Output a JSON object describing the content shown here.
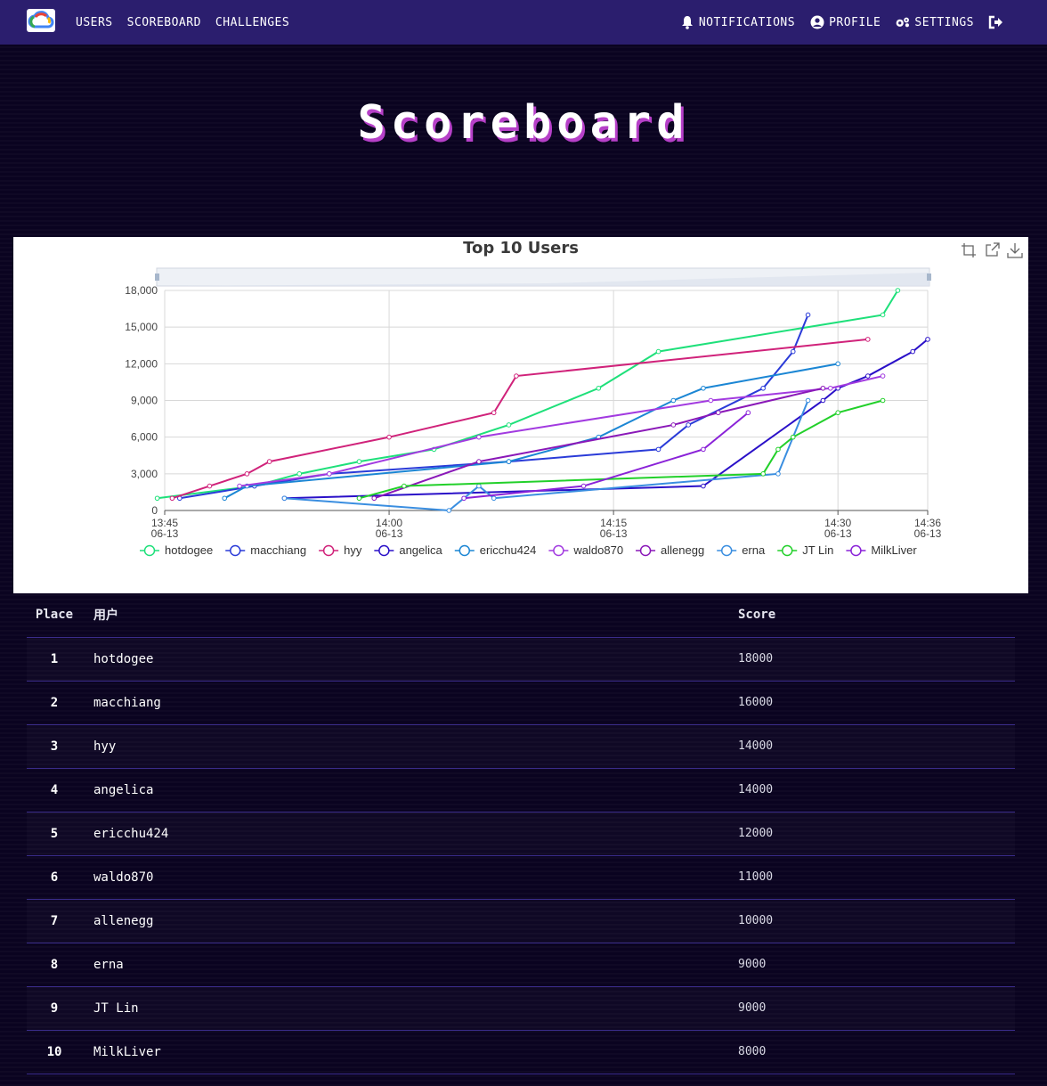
{
  "nav": {
    "left": [
      {
        "label": "USERS"
      },
      {
        "label": "SCOREBOARD"
      },
      {
        "label": "CHALLENGES"
      }
    ],
    "right": [
      {
        "label": "NOTIFICATIONS",
        "icon": "bell-icon"
      },
      {
        "label": "PROFILE",
        "icon": "user-circle-icon"
      },
      {
        "label": "SETTINGS",
        "icon": "gears-icon"
      }
    ],
    "logout_icon": "sign-out-icon",
    "brand_icon": "cloud-logo-icon",
    "background": "#2b1e6e"
  },
  "page": {
    "title": "Scoreboard",
    "title_shadow_color": "#b640c8",
    "background": "#0a0320"
  },
  "chart_data": {
    "type": "line",
    "title": "Top 10 Users",
    "xlabel": "",
    "ylabel": "",
    "ylim": [
      0,
      18000
    ],
    "yticks": [
      0,
      3000,
      6000,
      9000,
      12000,
      15000,
      18000
    ],
    "ytick_labels": [
      "0",
      "3,000",
      "6,000",
      "9,000",
      "12,000",
      "15,000",
      "18,000"
    ],
    "xlim": [
      "13:45",
      "14:36"
    ],
    "xticks": [
      {
        "time": "13:45",
        "date": "06-13"
      },
      {
        "time": "14:00",
        "date": "06-13"
      },
      {
        "time": "14:15",
        "date": "06-13"
      },
      {
        "time": "14:30",
        "date": "06-13"
      },
      {
        "time": "14:36",
        "date": "06-13"
      }
    ],
    "grid": true,
    "legend_position": "bottom",
    "toolbox": [
      "zoom-icon",
      "restore-icon",
      "download-icon"
    ],
    "datazoom_slider": true,
    "series": [
      {
        "name": "hotdogee",
        "color": "#1ee07a",
        "points": [
          [
            "13:44.5",
            1000
          ],
          [
            "13:51",
            2000
          ],
          [
            "13:54",
            3000
          ],
          [
            "13:58",
            4000
          ],
          [
            "14:03",
            5000
          ],
          [
            "14:08",
            7000
          ],
          [
            "14:14",
            10000
          ],
          [
            "14:18",
            13000
          ],
          [
            "14:33",
            16000
          ],
          [
            "14:34",
            18000
          ]
        ]
      },
      {
        "name": "macchiang",
        "color": "#2a3bd8",
        "points": [
          [
            "13:46",
            1000
          ],
          [
            "13:51",
            2000
          ],
          [
            "13:56",
            3000
          ],
          [
            "14:08",
            4000
          ],
          [
            "14:18",
            5000
          ],
          [
            "14:20",
            7000
          ],
          [
            "14:25",
            10000
          ],
          [
            "14:27",
            13000
          ],
          [
            "14:28",
            16000
          ]
        ]
      },
      {
        "name": "hyy",
        "color": "#d0227a",
        "points": [
          [
            "13:45.5",
            1000
          ],
          [
            "13:48",
            2000
          ],
          [
            "13:50.5",
            3000
          ],
          [
            "13:52",
            4000
          ],
          [
            "14:00",
            6000
          ],
          [
            "14:07",
            8000
          ],
          [
            "14:08.5",
            11000
          ],
          [
            "14:32",
            14000
          ]
        ]
      },
      {
        "name": "angelica",
        "color": "#2a10c8",
        "points": [
          [
            "13:53",
            1000
          ],
          [
            "14:21",
            2000
          ],
          [
            "14:29",
            9000
          ],
          [
            "14:30",
            10000
          ],
          [
            "14:32",
            11000
          ],
          [
            "14:35",
            13000
          ],
          [
            "14:36",
            14000
          ]
        ]
      },
      {
        "name": "ericchu424",
        "color": "#1b86d4",
        "points": [
          [
            "13:49",
            1000
          ],
          [
            "13:50.5",
            2000
          ],
          [
            "14:08",
            4000
          ],
          [
            "14:14",
            6000
          ],
          [
            "14:19",
            9000
          ],
          [
            "14:21",
            10000
          ],
          [
            "14:30",
            12000
          ]
        ]
      },
      {
        "name": "waldo870",
        "color": "#a23ae0",
        "points": [
          [
            "13:50",
            2000
          ],
          [
            "13:56",
            3000
          ],
          [
            "14:06",
            6000
          ],
          [
            "14:21.5",
            9000
          ],
          [
            "14:29.5",
            10000
          ],
          [
            "14:33",
            11000
          ]
        ]
      },
      {
        "name": "allenegg",
        "color": "#8a18b8",
        "points": [
          [
            "13:59",
            1000
          ],
          [
            "14:06",
            4000
          ],
          [
            "14:19",
            7000
          ],
          [
            "14:22",
            8000
          ],
          [
            "14:29",
            10000
          ]
        ]
      },
      {
        "name": "erna",
        "color": "#3a8ee0",
        "points": [
          [
            "13:53",
            1000
          ],
          [
            "14:04",
            0
          ],
          [
            "14:06",
            2000
          ],
          [
            "14:07",
            1000
          ],
          [
            "14:26",
            3000
          ],
          [
            "14:28",
            9000
          ]
        ]
      },
      {
        "name": "JT Lin",
        "color": "#22d02a",
        "points": [
          [
            "13:58",
            1000
          ],
          [
            "14:01",
            2000
          ],
          [
            "14:25",
            3000
          ],
          [
            "14:26",
            5000
          ],
          [
            "14:27",
            6000
          ],
          [
            "14:30",
            8000
          ],
          [
            "14:33",
            9000
          ]
        ]
      },
      {
        "name": "MilkLiver",
        "color": "#8a22d8",
        "points": [
          [
            "14:05",
            1000
          ],
          [
            "14:13",
            2000
          ],
          [
            "14:21",
            5000
          ],
          [
            "14:24",
            8000
          ]
        ]
      }
    ]
  },
  "table": {
    "headers": {
      "place": "Place",
      "user": "用户",
      "score": "Score"
    },
    "rows": [
      {
        "place": "1",
        "user": "hotdogee",
        "score": "18000"
      },
      {
        "place": "2",
        "user": "macchiang",
        "score": "16000"
      },
      {
        "place": "3",
        "user": "hyy",
        "score": "14000"
      },
      {
        "place": "4",
        "user": "angelica",
        "score": "14000"
      },
      {
        "place": "5",
        "user": "ericchu424",
        "score": "12000"
      },
      {
        "place": "6",
        "user": "waldo870",
        "score": "11000"
      },
      {
        "place": "7",
        "user": "allenegg",
        "score": "10000"
      },
      {
        "place": "8",
        "user": "erna",
        "score": "9000"
      },
      {
        "place": "9",
        "user": "JT Lin",
        "score": "9000"
      },
      {
        "place": "10",
        "user": "MilkLiver",
        "score": "8000"
      }
    ]
  }
}
